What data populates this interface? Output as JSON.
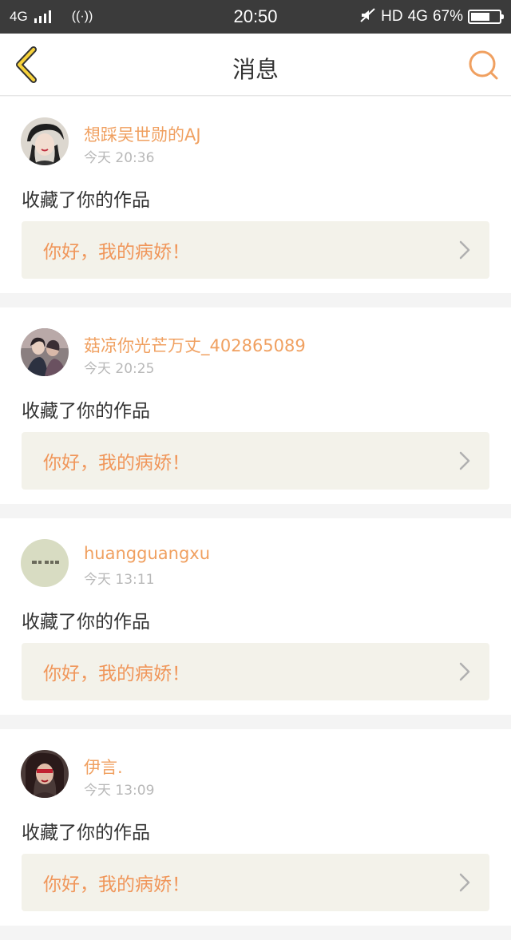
{
  "status_bar": {
    "network": "4G",
    "time": "20:50",
    "hd": "HD",
    "network2": "4G",
    "battery": "67%",
    "battery_level": 0.67
  },
  "header": {
    "title": "消息"
  },
  "messages": [
    {
      "username": "想踩吴世勋的AJ",
      "time": "今天 20:36",
      "action": "收藏了你的作品",
      "work_title": "你好，我的病娇！"
    },
    {
      "username": "菇凉你光芒万丈_402865089",
      "time": "今天 20:25",
      "action": "收藏了你的作品",
      "work_title": "你好，我的病娇！"
    },
    {
      "username": "huangguangxu",
      "time": "今天 13:11",
      "action": "收藏了你的作品",
      "work_title": "你好，我的病娇！"
    },
    {
      "username": "伊言.",
      "time": "今天 13:09",
      "action": "收藏了你的作品",
      "work_title": "你好，我的病娇！"
    }
  ],
  "colors": {
    "accent": "#f0a060",
    "status_bar": "#3b3b3b",
    "card_bg": "#f3f2ea"
  }
}
